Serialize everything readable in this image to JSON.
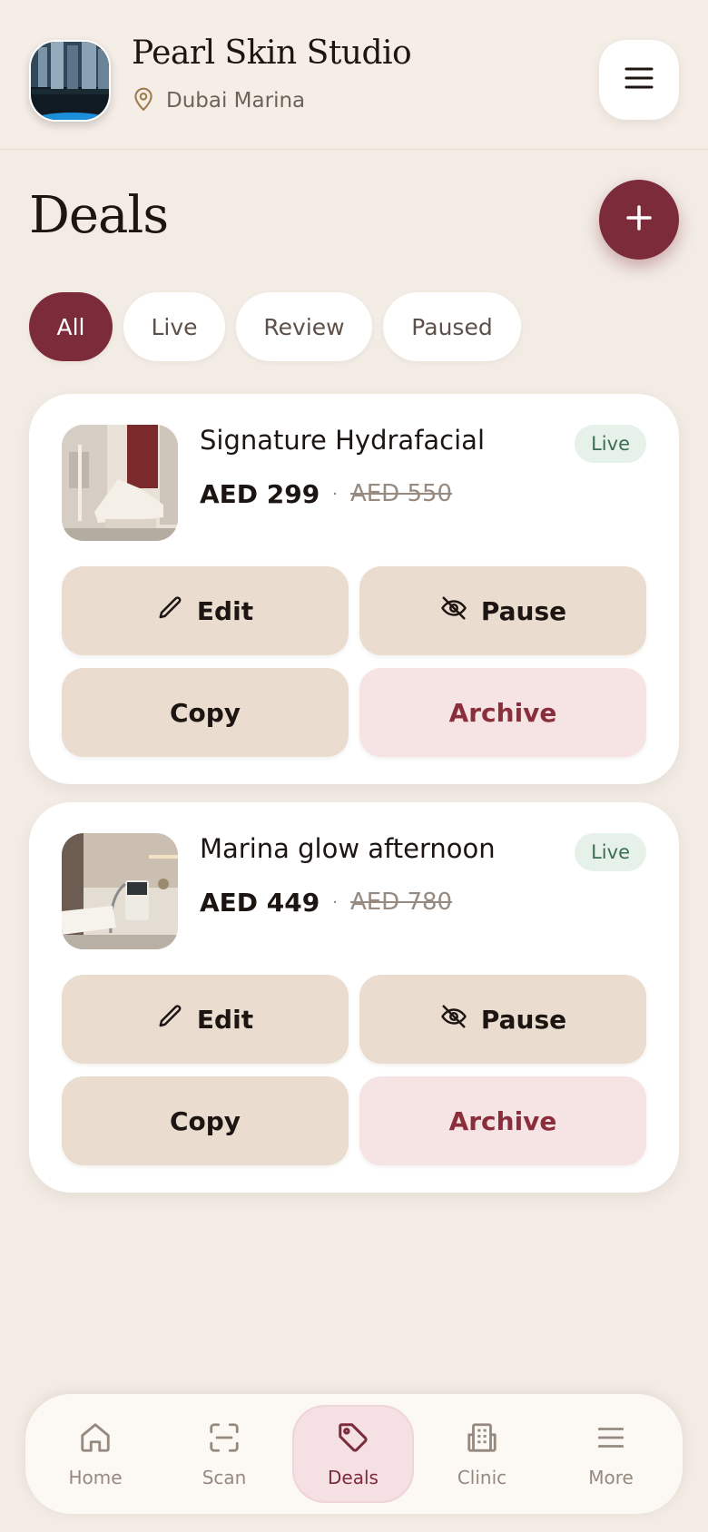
{
  "header": {
    "brand_name": "Pearl Skin Studio",
    "location": "Dubai Marina",
    "icons": {
      "location": "map-pin-icon",
      "menu": "hamburger-menu-icon"
    }
  },
  "page": {
    "title": "Deals",
    "add_icon": "plus-icon"
  },
  "filters": {
    "selected": "All",
    "chips": [
      "All",
      "Live",
      "Review",
      "Paused"
    ]
  },
  "deals": [
    {
      "title": "Signature Hydrafacial",
      "price": "AED 299",
      "separator": "·",
      "old_price": "AED 550",
      "status": "Live",
      "actions": {
        "edit": "Edit",
        "pause": "Pause",
        "copy": "Copy",
        "archive": "Archive"
      }
    },
    {
      "title": "Marina glow afternoon",
      "price": "AED 449",
      "separator": "·",
      "old_price": "AED 780",
      "status": "Live",
      "actions": {
        "edit": "Edit",
        "pause": "Pause",
        "copy": "Copy",
        "archive": "Archive"
      }
    }
  ],
  "nav": {
    "active": "Deals",
    "items": [
      {
        "label": "Home",
        "icon": "home-icon"
      },
      {
        "label": "Scan",
        "icon": "scan-icon"
      },
      {
        "label": "Deals",
        "icon": "tag-icon"
      },
      {
        "label": "Clinic",
        "icon": "building-icon"
      },
      {
        "label": "More",
        "icon": "menu-icon"
      }
    ]
  },
  "colors": {
    "accent": "#7c2b3b",
    "background": "#f3ece5",
    "live_badge_bg": "#e6f1ea",
    "live_badge_text": "#3c6e52",
    "archive_bg": "#f6e4e5",
    "action_bg": "#eaddd0"
  }
}
